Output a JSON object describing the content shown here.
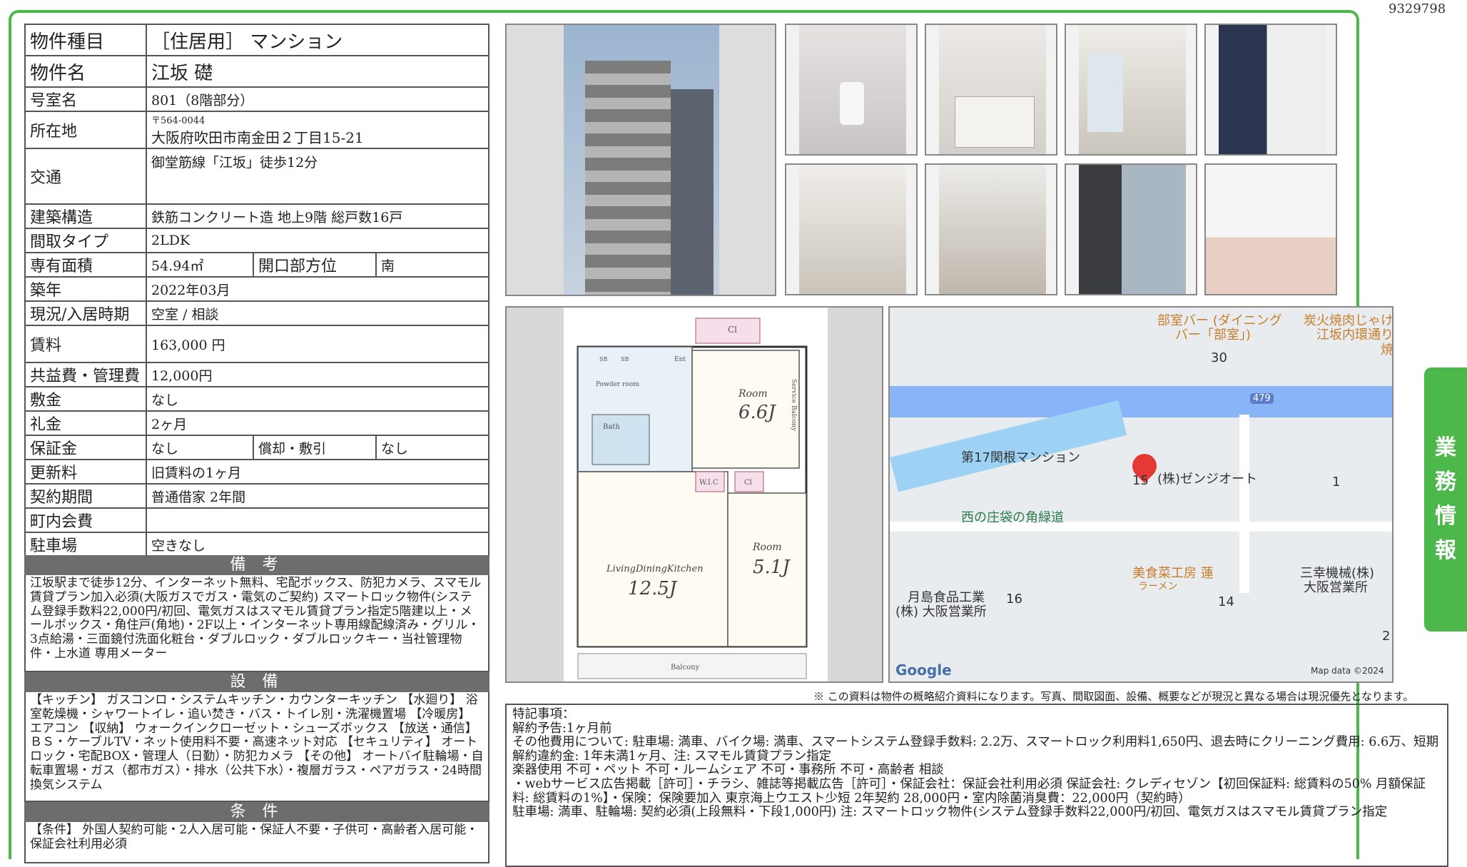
{
  "doc_id": "9329798",
  "sidebar_tab": [
    "業",
    "務",
    "情",
    "報"
  ],
  "rows": {
    "type_label": "物件種目",
    "type_value": "［住居用］ マンション",
    "name_label": "物件名",
    "name_value": "江坂 礎",
    "room_label": "号室名",
    "room_value": "801（8階部分）",
    "addr_label": "所在地",
    "addr_zip": "〒564-0044",
    "addr_value": "大阪府吹田市南金田２丁目15-21",
    "transit_label": "交通",
    "transit_value": "御堂筋線「江坂」徒歩12分",
    "structure_label": "建築構造",
    "structure_value": "鉄筋コンクリート造 地上9階 総戸数16戸",
    "layout_label": "間取タイプ",
    "layout_value": "2LDK",
    "area_label": "専有面積",
    "area_value": "54.94㎡",
    "dir_label": "開口部方位",
    "dir_value": "南",
    "built_label": "築年",
    "built_value": "2022年03月",
    "status_label": "現況/入居時期",
    "status_value": "空室 / 相談",
    "rent_label": "賃料",
    "rent_value": "163,000 円",
    "fee_label": "共益費・管理費",
    "fee_value": "12,000円",
    "deposit_label": "敷金",
    "deposit_value": "なし",
    "key_label": "礼金",
    "key_value": "2ヶ月",
    "guarantee_label": "保証金",
    "guarantee_value": "なし",
    "amort_label": "償却・敷引",
    "amort_value": "なし",
    "renew_label": "更新料",
    "renew_value": "旧賃料の1ヶ月",
    "contract_label": "契約期間",
    "contract_value": "普通借家 2年間",
    "town_label": "町内会費",
    "town_value": "",
    "parking_label": "駐車場",
    "parking_value": "空きなし"
  },
  "sections": {
    "notes_title": "備 考",
    "notes_text": "江坂駅まで徒歩12分、インターネット無料、宅配ボックス、防犯カメラ、スマモル賃貸プラン加入必須(大阪ガスでガス・電気のご契約) スマートロック物件(システム登録手数料22,000円/初回、電気ガスはスマモル賃貸プラン指定5階建以上・メールボックス・角住戸(角地)・2F以上・インターネット専用線配線済み・グリル・3点給湯・三面鏡付洗面化粧台・ダブルロック・ダブルロックキー・当社管理物件・上水道 専用メーター",
    "equip_title": "設 備",
    "equip_text": "【キッチン】 ガスコンロ・システムキッチン・カウンターキッチン 【水廻り】 浴室乾燥機・シャワートイレ・追い焚き・バス・トイレ別・洗濯機置場 【冷暖房】 エアコン 【収納】 ウォークインクローゼット・シューズボックス 【放送・通信】 ＢＳ・ケーブルTV・ネット使用料不要・高速ネット対応 【セキュリティ】 オートロック・宅配BOX・管理人（日勤）・防犯カメラ 【その他】 オートバイ駐輪場・自転車置場・ガス（都市ガス）・排水（公共下水）・複層ガラス・ペアガラス・24時間換気システム",
    "cond_title": "条 件",
    "cond_text": "【条件】 外国人契約可能・2人入居可能・保証人不要・子供可・高齢者入居可能・保証会社利用必須"
  },
  "floorplan": {
    "rooms": [
      "Cl",
      "Room",
      "6.6J",
      "Room",
      "5.1J",
      "LivingDiningKitchen",
      "12.5J",
      "W.I.C",
      "Cl",
      "Bath",
      "Powder room",
      "Balcony",
      "Service Balcony",
      "Ent",
      "SB",
      "SB"
    ]
  },
  "map": {
    "labels": [
      "部室バー (ダイニング",
      "バー「部室」)",
      "炭火焼肉じゃけ",
      "江坂内環通り",
      "30",
      "479",
      "第17関根マンション",
      "(株)ゼンジオート",
      "15",
      "1",
      "西の庄袋の角緑道",
      "美食菜工房 蓮",
      "ラーメン",
      "三幸機械(株)",
      "大阪営業所",
      "月島食品工業",
      "(株) 大阪営業所",
      "16",
      "14",
      "2",
      "焼"
    ],
    "brand": "Google",
    "attribution": "Map data ©2024"
  },
  "disclaimer": "※ この資料は物件の概略紹介資料になります。写真、間取図面、設備、概要などが現況と異なる場合は現況優先となります。",
  "remarks": {
    "title": "特記事項：",
    "lines": [
      "解約予告:1ヶ月前",
      "その他費用について: 駐車場: 満車、バイク場: 満車、スマートシステム登録手数料: 2.2万、スマートロック利用料1,650円、退去時にクリーニング費用: 6.6万、短期解約違約金: 1年未満1ヶ月、注: スマモル賃貸プラン指定",
      "楽器使用 不可・ペット 不可・ルームシェア 不可・事務所 不可・高齢者 相談",
      "・webサービス広告掲載［許可］・チラシ、雑誌等掲載広告［許可］・保証会社：保証会社利用必須 保証会社: クレディセゾン【初回保証料: 総賃料の50% 月額保証料: 総賃料の1%】・保険：保険要加入 東京海上ウエスト少短 2年契約 28,000円・室内除菌消臭費：22,000円（契約時）",
      "駐車場: 満車、駐輪場: 契約必須(上段無料・下段1,000円) 注: スマートロック物件(システム登録手数料22,000円/初回、電気ガスはスマモル賃貸プラン指定"
    ]
  }
}
